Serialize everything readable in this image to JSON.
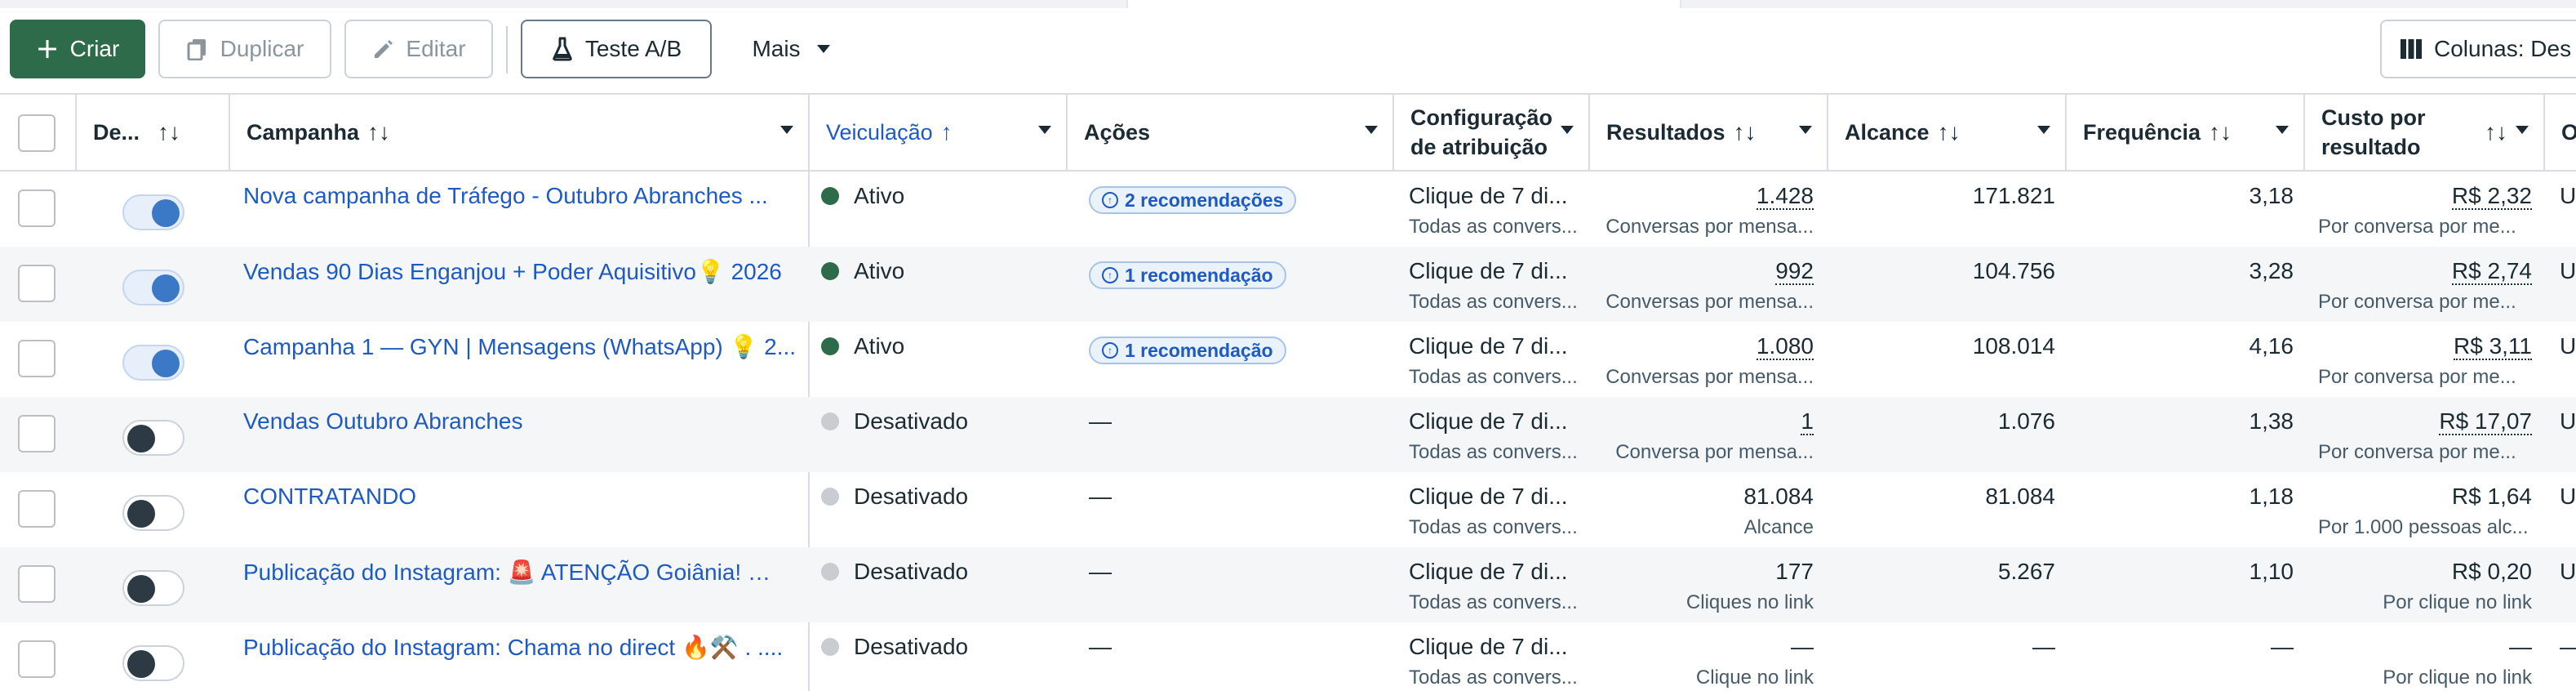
{
  "toolbar": {
    "create_label": "Criar",
    "duplicate_label": "Duplicar",
    "edit_label": "Editar",
    "ab_test_label": "Teste A/B",
    "more_label": "Mais",
    "columns_label": "Colunas: Des"
  },
  "columns": {
    "delivery_short": "De...",
    "campaign": "Campanha",
    "veiculacao": "Veiculação",
    "actions": "Ações",
    "attribution_line1": "Configuração",
    "attribution_line2": "de atribuição",
    "results": "Resultados",
    "reach": "Alcance",
    "frequency": "Frequência",
    "cost_line1": "Custo por",
    "cost_line2": "resultado",
    "last": "O"
  },
  "rows": [
    {
      "name": "Nova campanha de Tráfego - Outubro Abranches ...",
      "toggle": "on",
      "status": "Ativo",
      "status_type": "active",
      "action": "2 recomendações",
      "action_pill": true,
      "attr1": "Clique de 7 di...",
      "attr2": "Todas as convers...",
      "res1": "1.428",
      "res1_underline": true,
      "res2": "Conversas por mensa...",
      "reach": "171.821",
      "freq": "3,18",
      "cost1": "R$ 2,32",
      "cost1_underline": true,
      "cost2": "Por conversa por me...",
      "cost2_right": false,
      "last": "U"
    },
    {
      "name": "Vendas 90 Dias Enganjou + Poder Aquisitivo💡 2026",
      "toggle": "on",
      "status": "Ativo",
      "status_type": "active",
      "action": "1 recomendação",
      "action_pill": true,
      "attr1": "Clique de 7 di...",
      "attr2": "Todas as convers...",
      "res1": "992",
      "res1_underline": true,
      "res2": "Conversas por mensa...",
      "reach": "104.756",
      "freq": "3,28",
      "cost1": "R$ 2,74",
      "cost1_underline": true,
      "cost2": "Por conversa por me...",
      "cost2_right": false,
      "last": "U"
    },
    {
      "name": "Campanha 1 — GYN | Mensagens (WhatsApp) 💡 2...",
      "toggle": "on",
      "status": "Ativo",
      "status_type": "active",
      "action": "1 recomendação",
      "action_pill": true,
      "attr1": "Clique de 7 di...",
      "attr2": "Todas as convers...",
      "res1": "1.080",
      "res1_underline": true,
      "res2": "Conversas por mensa...",
      "reach": "108.014",
      "freq": "4,16",
      "cost1": "R$ 3,11",
      "cost1_underline": true,
      "cost2": "Por conversa por me...",
      "cost2_right": false,
      "last": "U"
    },
    {
      "name": "Vendas Outubro Abranches",
      "toggle": "off",
      "status": "Desativado",
      "status_type": "off",
      "action": "—",
      "action_pill": false,
      "attr1": "Clique de 7 di...",
      "attr2": "Todas as convers...",
      "res1": "1",
      "res1_underline": true,
      "res2": "Conversa por mensa...",
      "reach": "1.076",
      "freq": "1,38",
      "cost1": "R$ 17,07",
      "cost1_underline": true,
      "cost2": "Por conversa por me...",
      "cost2_right": false,
      "last": "U"
    },
    {
      "name": "CONTRATANDO",
      "toggle": "off",
      "status": "Desativado",
      "status_type": "off",
      "action": "—",
      "action_pill": false,
      "attr1": "Clique de 7 di...",
      "attr2": "Todas as convers...",
      "res1": "81.084",
      "res1_underline": false,
      "res2": "Alcance",
      "reach": "81.084",
      "freq": "1,18",
      "cost1": "R$ 1,64",
      "cost1_underline": false,
      "cost2": "Por 1.000 pessoas alc...",
      "cost2_right": false,
      "last": "U"
    },
    {
      "name": "Publicação do Instagram: 🚨 ATENÇÃO Goiânia! 🚨 ...",
      "toggle": "off",
      "status": "Desativado",
      "status_type": "off",
      "action": "—",
      "action_pill": false,
      "attr1": "Clique de 7 di...",
      "attr2": "Todas as convers...",
      "res1": "177",
      "res1_underline": false,
      "res2": "Cliques no link",
      "reach": "5.267",
      "freq": "1,10",
      "cost1": "R$ 0,20",
      "cost1_underline": false,
      "cost2": "Por clique no link",
      "cost2_right": true,
      "last": "U"
    },
    {
      "name": "Publicação do Instagram: Chama no direct 🔥⚒️ . ....",
      "toggle": "off",
      "status": "Desativado",
      "status_type": "off",
      "action": "—",
      "action_pill": false,
      "attr1": "Clique de 7 di...",
      "attr2": "Todas as convers...",
      "res1": "—",
      "res1_underline": false,
      "res2": "Clique no link",
      "reach": "—",
      "freq": "—",
      "cost1": "—",
      "cost1_underline": false,
      "cost2": "Por clique no link",
      "cost2_right": true,
      "last": "—"
    }
  ],
  "colors": {
    "primary": "#2e6b4a",
    "link": "#1d5ac4",
    "active_dot": "#2e6b4a",
    "off_dot": "#c9ccd1"
  }
}
